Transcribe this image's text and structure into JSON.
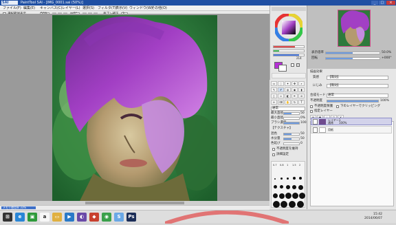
{
  "window": {
    "logo": "SAI",
    "title": "PaintTool SAI - [IMG_0001.sai (50%)]",
    "minimize": "_",
    "maximize": "□",
    "close": "×"
  },
  "menu": [
    "ファイル(F)",
    "編集(E)",
    "キャンバス(C)",
    "レイヤー(L)",
    "選択(S)",
    "フィルタ(T)",
    "表示(V)",
    "ウィンドウ(W)",
    "その他(O)"
  ],
  "toolbar": {
    "selection_label": "選択範囲表示",
    "zoom_value": "50%",
    "angle_value": "+0°",
    "stabilizer_label": "手ブレ補正",
    "stabilizer_value": "3"
  },
  "navigator": {
    "zoom_label": "表示倍率",
    "zoom_value": "50.0%",
    "angle_label": "回転",
    "angle_value": "+000°"
  },
  "color": {
    "current": "#b52fd6",
    "secondary": "#ffffff",
    "r_value": "181",
    "g_value": "47",
    "b_value": "214"
  },
  "brush": {
    "mode_label": "通常",
    "size_label": "最大直径",
    "size_value": "50",
    "min_label": "最小直径",
    "min_value": "0%",
    "density_label": "ブラシ濃度",
    "density_value": "100",
    "texture_label": "【テクスチャ】",
    "blend_label": "混色",
    "blend_value": "50",
    "water_label": "水分量",
    "water_value": "50",
    "persist_label": "色延び",
    "persist_value": "0",
    "keep_opacity_label": "不透明度を維持",
    "detail_label": "詳細設定",
    "size_presets": [
      "0.7",
      "0.8",
      "1",
      "1.5",
      "2",
      "2.3",
      "2.6",
      "3",
      "3.5",
      "4"
    ]
  },
  "layer": {
    "effect_label": "描画効果",
    "texture_label": "質感",
    "texture_value": "【無効】",
    "blend_label": "にじみ",
    "blend_value": "【無効】",
    "mode_label": "合成モード",
    "mode_value": "通常",
    "opacity_label": "不透明度",
    "opacity_value": "100%",
    "protect_label": "不透明度保護",
    "clip_label": "下のレイヤーでクリッピング",
    "ref_label": "指定レイヤー",
    "layers": [
      {
        "name": "レイヤー1",
        "mode": "通常",
        "opacity": "100%"
      },
      {
        "name": "用紙",
        "mode": "",
        "opacity": ""
      }
    ]
  },
  "status": {
    "memory": "メモリ使用率 33%",
    "zoom": "50%"
  },
  "taskbar": {
    "icons": [
      "start",
      "ie",
      "store",
      "amazon",
      "folder",
      "media",
      "photos",
      "apps",
      "chrome",
      "sai",
      "photoshop"
    ],
    "time": "15:42",
    "date": "2014/06/07"
  }
}
